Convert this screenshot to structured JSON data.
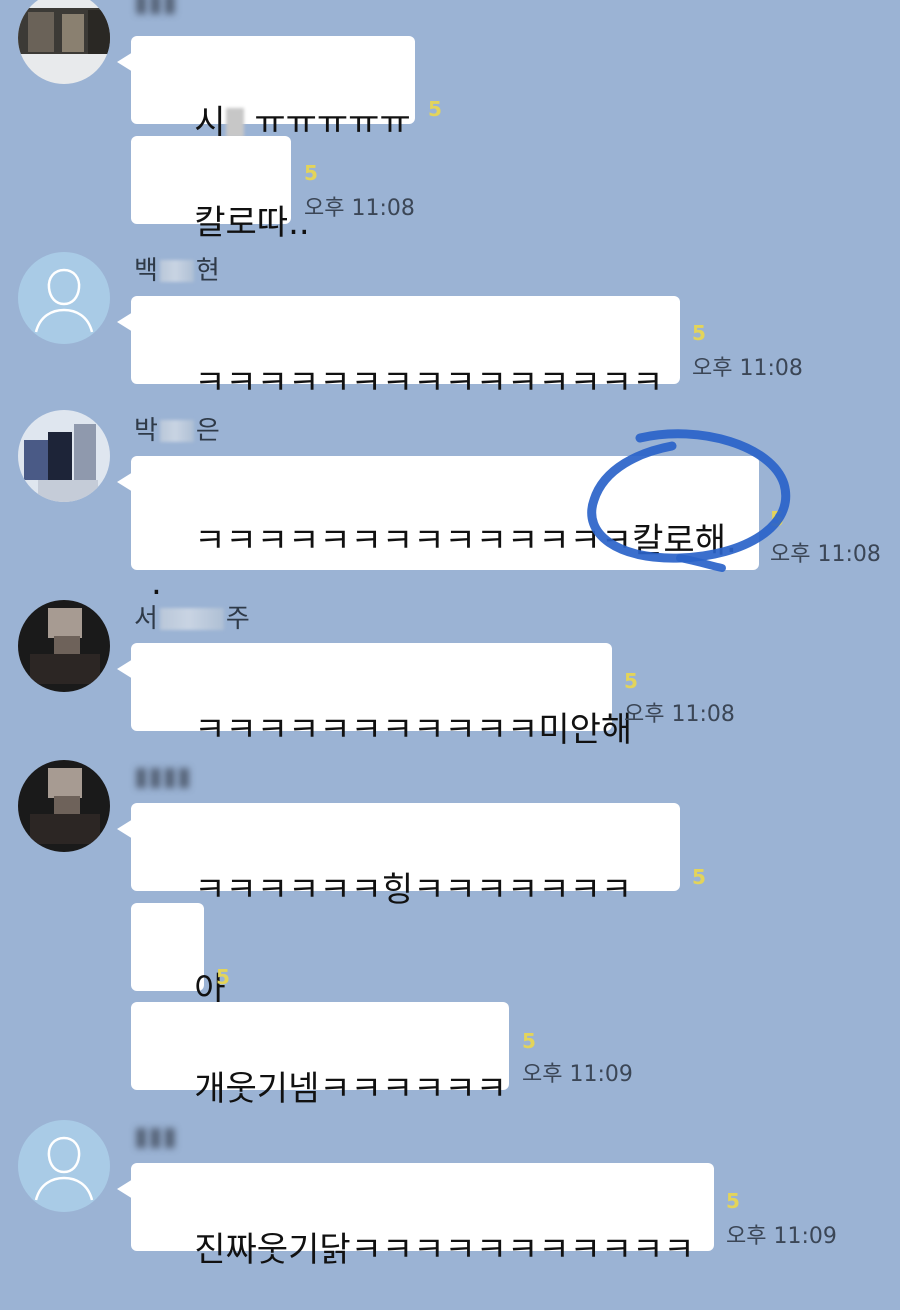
{
  "colors": {
    "background": "#9bb3d4",
    "bubble": "#ffffff",
    "unread": "#e3d45a",
    "annotation_circle": "#2a63c9"
  },
  "messages": [
    {
      "sender_visible": "",
      "text_pre": "시",
      "text_post": " ㅠㅠㅠㅠㅠ",
      "unread": "5",
      "time": ""
    },
    {
      "text": "칼로따..",
      "unread": "5",
      "time": "오후 11:08"
    },
    {
      "sender_pre": "백",
      "sender_post": "현",
      "text": "ㅋㅋㅋㅋㅋㅋㅋㅋㅋㅋㅋㅋㅋㅋㅋ",
      "unread": "5",
      "time": "오후 11:08"
    },
    {
      "sender_pre": "박",
      "sender_post": "은",
      "text": "ㅋㅋㅋㅋㅋㅋㅋㅋㅋㅋㅋㅋㅋㅋ칼로해.\n.",
      "unread": "5",
      "time": "오후 11:08"
    },
    {
      "sender_pre": "서",
      "sender_post": "주",
      "text": "ㅋㅋㅋㅋㅋㅋㅋㅋㅋㅋㅋ미안해",
      "unread": "5",
      "time": "오후 11:08"
    },
    {
      "text": "ㅋㅋㅋㅋㅋㅋ힝ㅋㅋㅋㅋㅋㅋㅋ",
      "unread": "5",
      "time": ""
    },
    {
      "text": "아",
      "unread": "5",
      "time": ""
    },
    {
      "text": "개웃기넴ㅋㅋㅋㅋㅋㅋ",
      "unread": "5",
      "time": "오후 11:09"
    },
    {
      "text": "진짜웃기닭ㅋㅋㅋㅋㅋㅋㅋㅋㅋㅋㅋ",
      "unread": "5",
      "time": "오후 11:09"
    }
  ]
}
